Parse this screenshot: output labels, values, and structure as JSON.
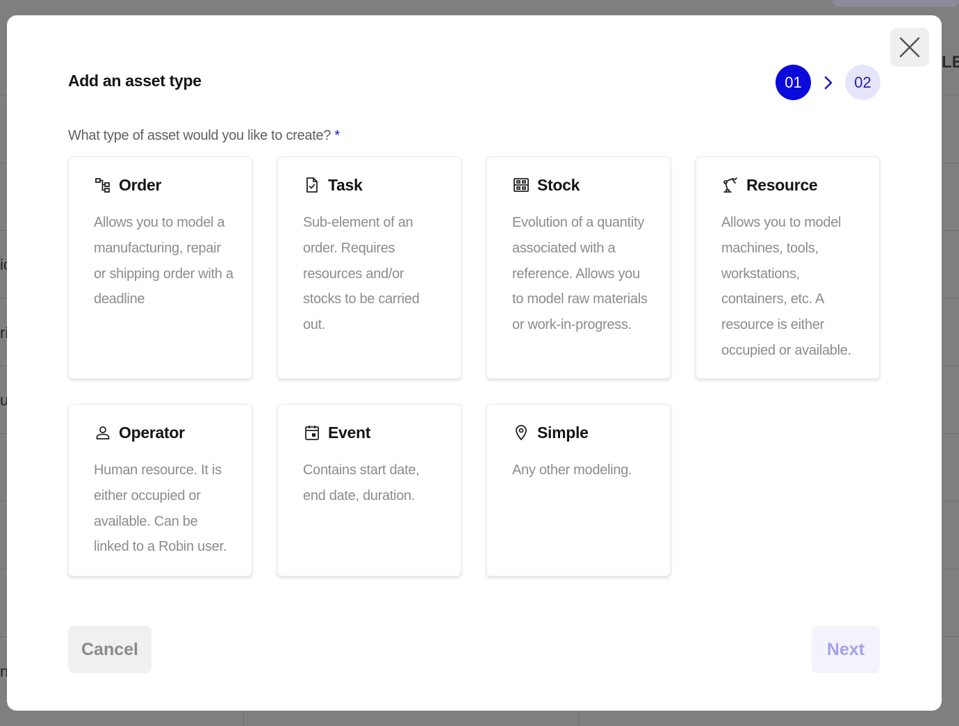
{
  "background": {
    "left_letters": [
      "ic",
      "ri",
      "u",
      "n"
    ],
    "right_text": "LE"
  },
  "modal": {
    "title": "Add an asset type",
    "close_label": "Close",
    "stepper": {
      "steps": [
        {
          "label": "01",
          "active": true
        },
        {
          "label": "02",
          "active": false
        }
      ]
    },
    "question": {
      "text": "What type of asset would you like to create?",
      "required_marker": "*"
    },
    "asset_types": [
      {
        "icon": "order-icon",
        "title": "Order",
        "description": "Allows you to model a manufacturing, repair or shipping order with a deadline"
      },
      {
        "icon": "task-icon",
        "title": "Task",
        "description": "Sub-element of an order. Requires resources and/or stocks to be carried out."
      },
      {
        "icon": "stock-icon",
        "title": "Stock",
        "description": "Evolution of a quantity associated with a reference. Allows you to model raw materials or work-in-progress."
      },
      {
        "icon": "resource-icon",
        "title": "Resource",
        "description": "Allows you to model machines, tools, workstations, containers, etc. A resource is either occupied or available."
      },
      {
        "icon": "operator-icon",
        "title": "Operator",
        "description": "Human resource. It is either occupied or available. Can be linked to a Robin user."
      },
      {
        "icon": "event-icon",
        "title": "Event",
        "description": "Contains start date, end date, duration."
      },
      {
        "icon": "simple-icon",
        "title": "Simple",
        "description": "Any other modeling."
      }
    ],
    "footer": {
      "cancel_label": "Cancel",
      "next_label": "Next"
    },
    "colors": {
      "accent": "#0a0adb",
      "step_inactive": "#e6e5fb",
      "next_disabled_text": "#a6a2e8"
    }
  }
}
